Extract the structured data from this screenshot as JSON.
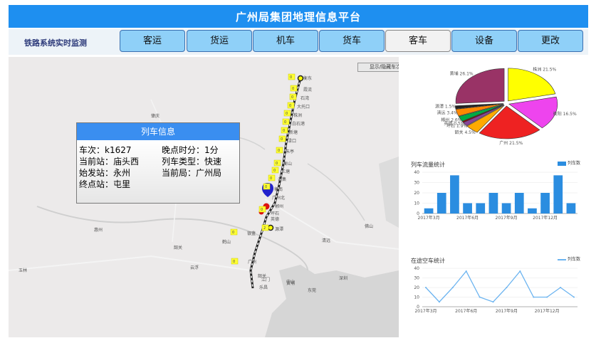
{
  "app": {
    "title": "广州局集团地理信息平台"
  },
  "nav": {
    "system_label": "铁路系统实时监测",
    "tabs": [
      "客运",
      "货运",
      "机车",
      "货车",
      "客车",
      "设备",
      "更改"
    ],
    "active": "客车"
  },
  "map": {
    "toggle_label": "显示/隐藏车次",
    "stations": [
      "衡东",
      "霞流",
      "石湾",
      "大托口",
      "株洲",
      "白石港",
      "新塘",
      "渌口",
      "朱亭",
      "衡山",
      "三塘",
      "云集",
      "衡南",
      "郴州",
      "坪石",
      "英德",
      "源潭",
      "银盏",
      "广州北",
      "广州",
      "韶关",
      "乐昌",
      "黄埔"
    ],
    "places": [
      "韶关",
      "云浮",
      "玉林",
      "江门",
      "中山",
      "深圳",
      "鹤山",
      "肇庆",
      "清远",
      "佛山",
      "东莞",
      "惠州"
    ],
    "counts": [
      "0",
      "0",
      "0",
      "0",
      "0",
      "0",
      "0",
      "0",
      "0",
      "0",
      "0",
      "0",
      "0",
      "0",
      "0",
      "0",
      "0",
      "0",
      "2"
    ]
  },
  "train_info": {
    "title": "列车信息",
    "train_no_label": "车次：",
    "train_no": "k1627",
    "delay_label": "晚点时分：",
    "delay": "1分",
    "current_station_label": "当前站：",
    "current_station": "庙头西",
    "train_type_label": "列车类型：",
    "train_type": "快速",
    "start_station_label": "始发站：",
    "start_station": "永州",
    "current_bureau_label": "当前局：",
    "current_bureau": "广州局",
    "end_station_label": "终点站：",
    "end_station": "屯里"
  },
  "bar_chart": {
    "title": "列车流量统计",
    "legend": "列车数",
    "chart_data": {
      "type": "bar",
      "categories": [
        "2017年3月",
        "",
        "",
        "2017年6月",
        "",
        "",
        "2017年9月",
        "",
        "",
        "2017年12月",
        "",
        ""
      ],
      "values": [
        5,
        20,
        37,
        10,
        10,
        20,
        10,
        20,
        5,
        20,
        37,
        10
      ],
      "ylim": [
        0,
        40
      ],
      "yticks": [
        "0",
        "10",
        "20",
        "30",
        "40"
      ],
      "xticks": [
        "2017年3月",
        "2017年6月",
        "2017年9月",
        "2017年12月"
      ],
      "color": "#2b8de0"
    }
  },
  "line_chart": {
    "title": "在途空车统计",
    "legend": "列车数",
    "chart_data": {
      "type": "line",
      "categories": [
        "2017年3月",
        "",
        "",
        "2017年6月",
        "",
        "",
        "2017年9月",
        "",
        "",
        "2017年12月",
        ""
      ],
      "values": [
        20,
        5,
        20,
        37,
        10,
        5,
        20,
        37,
        10,
        10,
        20,
        10
      ],
      "ylim": [
        0,
        40
      ],
      "yticks": [
        "0",
        "10",
        "20",
        "30",
        "40"
      ],
      "xticks": [
        "2017年3月",
        "2017年6月",
        "2017年9月",
        "2017年12月"
      ],
      "color": "#6cb4f0"
    }
  },
  "pie_chart": {
    "chart_data": {
      "type": "pie",
      "labels": [
        "株洲",
        "衡阳",
        "广州",
        "韶关",
        "坪石",
        "英德",
        "郴州",
        "清远",
        "源潭",
        "黄埔"
      ],
      "values": [
        21.5,
        16.5,
        21.5,
        4.5,
        1.9,
        0.5,
        2.6,
        3.4,
        1.5,
        26.1
      ],
      "colors": [
        "#ffff00",
        "#ee44ee",
        "#ee2222",
        "#ffaa00",
        "#884499",
        "#aa0000",
        "#00aa44",
        "#ff8800",
        "#222222",
        "#993366"
      ]
    }
  }
}
